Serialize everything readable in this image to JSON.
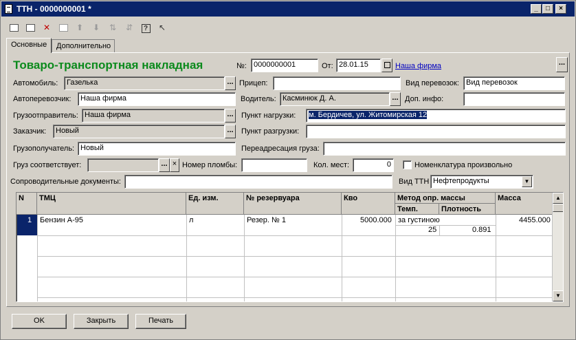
{
  "window": {
    "title": "ТТН - 0000000001 *"
  },
  "tabs": [
    {
      "label": "Основные",
      "active": true
    },
    {
      "label": "Дополнительно",
      "active": false
    }
  ],
  "form": {
    "heading": "Товаро-транспортная накладная",
    "number_label": "№:",
    "number_value": "0000000001",
    "date_label": "От:",
    "date_value": "28.01.15",
    "org_link": "Наша фирма",
    "vehicle_label": "Автомобиль:",
    "vehicle_value": "Газелька",
    "trailer_label": "Прицеп:",
    "trailer_value": "",
    "transport_type_label": "Вид перевозок:",
    "transport_type_value": "Вид перевозок",
    "carrier_label": "Автоперевозчик:",
    "carrier_value": "Наша фирма",
    "driver_label": "Водитель:",
    "driver_value": "Касминюк Д. А.",
    "extra_info_label": "Доп. инфо:",
    "extra_info_value": "",
    "shipper_label": "Грузоотправитель:",
    "shipper_value": "Наша фирма",
    "loading_point_label": "Пункт нагрузки:",
    "loading_point_value": "м. Бердичев, ул. Житомирская 12",
    "customer_label": "Заказчик:",
    "customer_value": "Новый",
    "unloading_point_label": "Пункт разгрузки:",
    "unloading_point_value": "",
    "consignee_label": "Грузополучатель:",
    "consignee_value": "Новый",
    "readdress_label": "Переадресация груза:",
    "readdress_value": "",
    "cargo_matches_label": "Груз соответствует:",
    "cargo_matches_value": "",
    "seal_label": "Номер пломбы:",
    "seal_value": "",
    "places_label": "Кол. мест:",
    "places_value": "0",
    "nomenclature_label": "Номенклатура произвольно",
    "docs_label": "Сопроводительные документы:",
    "docs_value": "",
    "ttn_type_label": "Вид ТТН",
    "ttn_type_value": "Нефтепродукты"
  },
  "table": {
    "headers": {
      "n": "N",
      "tmc": "ТМЦ",
      "unit": "Ед. изм.",
      "tank": "№ резервуара",
      "qty": "Кво",
      "method": "Метод опр. массы",
      "temp": "Темп.",
      "density": "Плотность",
      "mass": "Масса"
    },
    "rows": [
      {
        "n": "1",
        "tmc": "Бензин А-95",
        "unit": "л",
        "tank": "Резер. № 1",
        "qty": "5000.000",
        "method": "за густиною",
        "temp": "25",
        "density": "0.891",
        "mass": "4455.000"
      }
    ]
  },
  "buttons": {
    "ok": "OK",
    "close": "Закрыть",
    "print": "Печать",
    "ellipsis": "..."
  },
  "colors": {
    "heading": "#0b8a1c",
    "titlebar": "#0a246a",
    "link": "#0000c0"
  }
}
